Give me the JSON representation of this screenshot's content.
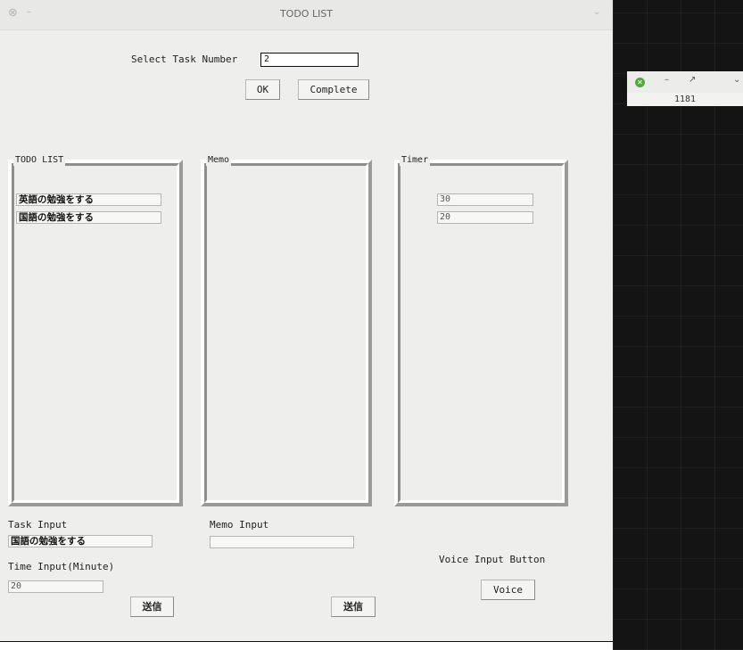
{
  "window": {
    "title": "TODO LIST"
  },
  "select_task": {
    "label": "Select Task Number",
    "value": "2"
  },
  "buttons": {
    "ok": "OK",
    "complete": "Complete",
    "send_task": "送信",
    "send_memo": "送信",
    "voice": "Voice"
  },
  "panels": {
    "todo": {
      "title": "TODO LIST",
      "items": [
        "英語の勉強をする",
        "国語の勉強をする"
      ]
    },
    "memo": {
      "title": "Memo",
      "items": []
    },
    "timer": {
      "title": "Timer",
      "items": [
        "30",
        "20"
      ]
    }
  },
  "inputs": {
    "task": {
      "label": "Task Input",
      "value": "国語の勉強をする"
    },
    "time": {
      "label": "Time Input(Minute)",
      "value": "20"
    },
    "memo": {
      "label": "Memo Input",
      "value": ""
    },
    "voice": {
      "label": "Voice Input Button"
    }
  },
  "mini_window": {
    "value": "1181"
  },
  "colors": {
    "desktop": "#141414",
    "window_bg": "#eeeeec",
    "mini_close": "#52a83e"
  }
}
